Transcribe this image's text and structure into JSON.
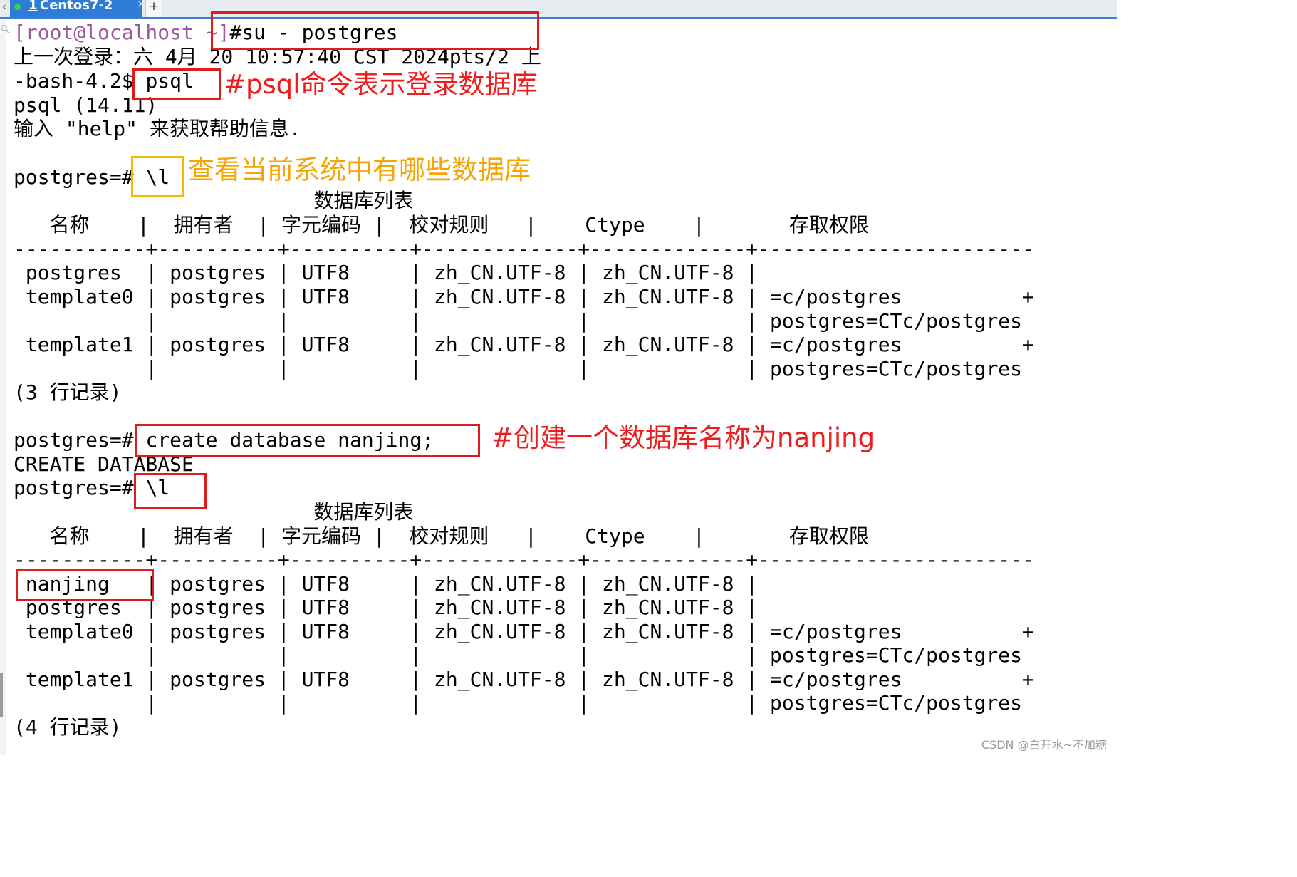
{
  "window": {
    "tab_label": "Centos7-2",
    "tab_number": "1",
    "tab_close": "×",
    "tab_add": "+",
    "tab_left_arrow": "‹",
    "left_edge_icon": "search-icon"
  },
  "terminal": {
    "l1_prompt": "[root@localhost ~]",
    "l1_cmd": "#su - postgres",
    "l2": "上一次登录：六 4月 20 10:57:40 CST 2024pts/2 上",
    "l3_prompt": "-bash-4.2$ ",
    "l3_cmd": "psql",
    "l4": "psql (14.11)",
    "l5": "输入 \"help\" 来获取帮助信息.",
    "l6_prompt": "postgres=# ",
    "l6_cmd": "\\l",
    "table1": {
      "title": "                         数据库列表",
      "header": "   名称    |  拥有者  | 字元编码 |  校对规则   |    Ctype    |       存取权限",
      "sep": "-----------+----------+----------+-------------+-------------+-----------------------",
      "r1": " postgres  | postgres | UTF8     | zh_CN.UTF-8 | zh_CN.UTF-8 |",
      "r2": " template0 | postgres | UTF8     | zh_CN.UTF-8 | zh_CN.UTF-8 | =c/postgres          +",
      "r3": "           |          |          |             |             | postgres=CTc/postgres",
      "r4": " template1 | postgres | UTF8     | zh_CN.UTF-8 | zh_CN.UTF-8 | =c/postgres          +",
      "r5": "           |          |          |             |             | postgres=CTc/postgres",
      "count": "(3 行记录)"
    },
    "l7_prompt": "postgres=# ",
    "l7_cmd": "create database nanjing;",
    "l8": "CREATE DATABASE",
    "l9_prompt": "postgres=# ",
    "l9_cmd": "\\l",
    "table2": {
      "title": "                         数据库列表",
      "header": "   名称    |  拥有者  | 字元编码 |  校对规则   |    Ctype    |       存取权限",
      "sep": "-----------+----------+----------+-------------+-------------+-----------------------",
      "r1": " nanjing   | postgres | UTF8     | zh_CN.UTF-8 | zh_CN.UTF-8 |",
      "r2": " postgres  | postgres | UTF8     | zh_CN.UTF-8 | zh_CN.UTF-8 |",
      "r3": " template0 | postgres | UTF8     | zh_CN.UTF-8 | zh_CN.UTF-8 | =c/postgres          +",
      "r4": "           |          |          |             |             | postgres=CTc/postgres",
      "r5": " template1 | postgres | UTF8     | zh_CN.UTF-8 | zh_CN.UTF-8 | =c/postgres          +",
      "r6": "           |          |          |             |             | postgres=CTc/postgres",
      "count": "(4 行记录)"
    }
  },
  "annotations": {
    "psql_note": "#psql命令表示登录数据库",
    "list_note": "查看当前系统中有哪些数据库",
    "create_note": "#创建一个数据库名称为nanjing",
    "red_color": "#e01b1b",
    "orange_color": "#f5b800"
  },
  "watermark": "CSDN @白开水~不加糖"
}
